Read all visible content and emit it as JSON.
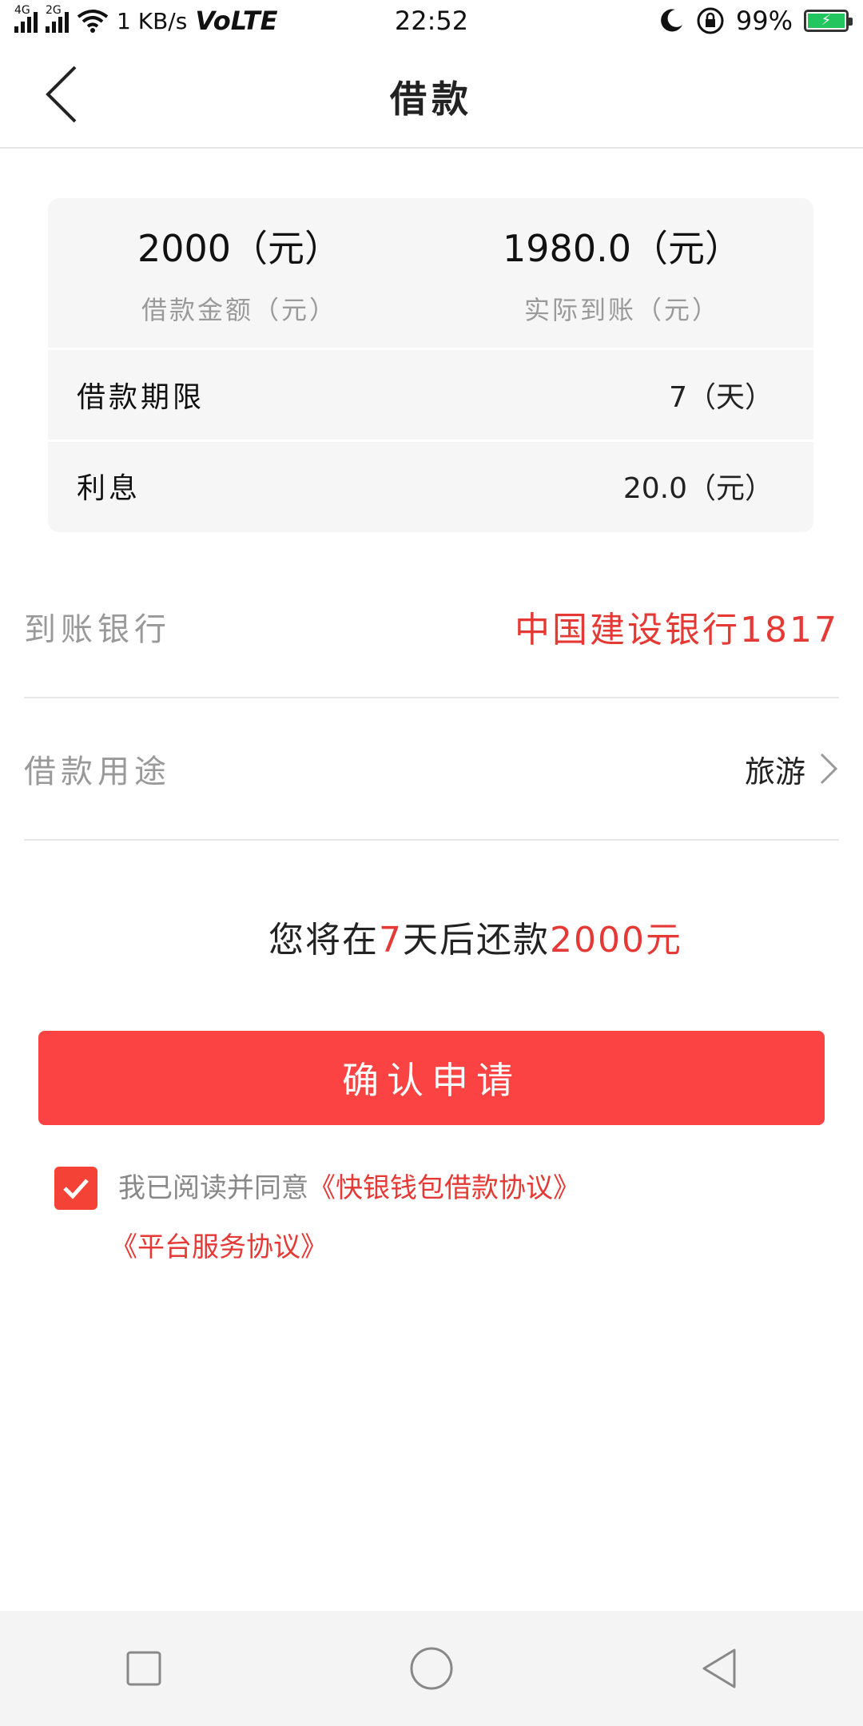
{
  "status_bar": {
    "network_tags": [
      "4G",
      "2G"
    ],
    "speed": "1 KB/s",
    "volte": "VoLTE",
    "time": "22:52",
    "battery": "99%"
  },
  "header": {
    "title": "借款"
  },
  "summary": {
    "loan_amount_value": "2000（元）",
    "loan_amount_label": "借款金额（元）",
    "actual_received_value": "1980.0（元）",
    "actual_received_label": "实际到账（元）",
    "term_label": "借款期限",
    "term_value": "7（天）",
    "interest_label": "利息",
    "interest_value": "20.0（元）"
  },
  "bank": {
    "label": "到账银行",
    "value": "中国建设银行1817"
  },
  "purpose": {
    "label": "借款用途",
    "value": "旅游"
  },
  "notice": {
    "prefix": "您将在",
    "days": "7",
    "middle": "天后还款",
    "amount": "2000元"
  },
  "confirm_button": "确认申请",
  "agreement": {
    "text": "我已阅读并同意",
    "link1": "《快银钱包借款协议》",
    "link2": "《平台服务协议》",
    "checked": true
  },
  "colors": {
    "accent": "#fb4343",
    "red_text": "#e53935"
  }
}
